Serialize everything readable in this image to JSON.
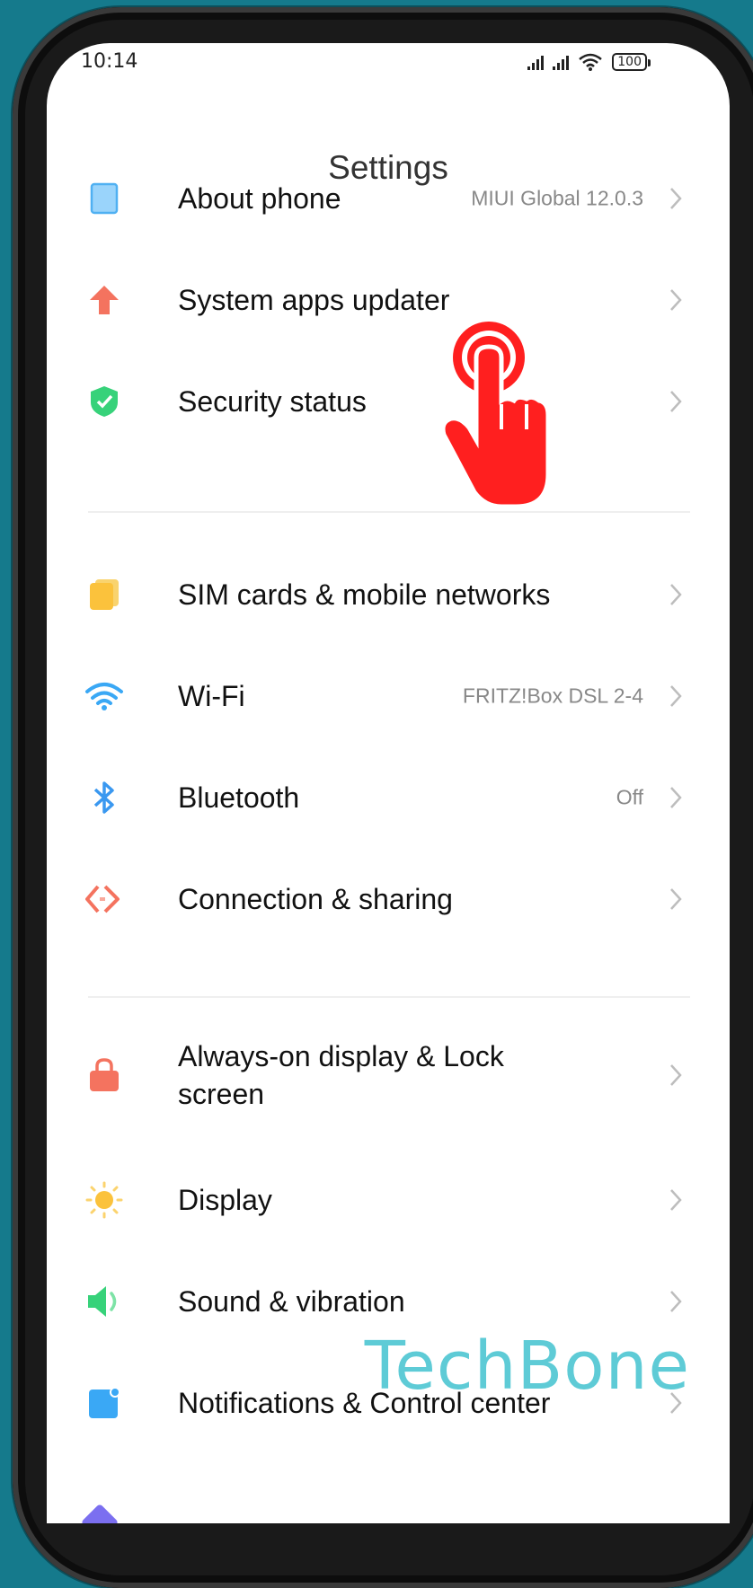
{
  "status_bar": {
    "time": "10:14",
    "battery": "100"
  },
  "header": {
    "title": "Settings"
  },
  "rows": [
    {
      "id": "about-phone",
      "label": "About phone",
      "value": "MIUI Global 12.0.3",
      "icon": "phone-icon",
      "color": "#62b8f5"
    },
    {
      "id": "system-apps-updater",
      "label": "System apps updater",
      "value": "",
      "icon": "arrow-up-icon",
      "color": "#f4735f"
    },
    {
      "id": "security-status",
      "label": "Security status",
      "value": "",
      "icon": "shield-check-icon",
      "color": "#37d27a"
    },
    {
      "id": "sim-cards",
      "label": "SIM cards & mobile networks",
      "value": "",
      "icon": "sim-card-icon",
      "color": "#fbc23c"
    },
    {
      "id": "wifi",
      "label": "Wi-Fi",
      "value": "FRITZ!Box DSL 2-4",
      "icon": "wifi-icon",
      "color": "#3aa8f5"
    },
    {
      "id": "bluetooth",
      "label": "Bluetooth",
      "value": "Off",
      "icon": "bluetooth-icon",
      "color": "#3a98f0"
    },
    {
      "id": "connection-sharing",
      "label": "Connection & sharing",
      "value": "",
      "icon": "connection-icon",
      "color": "#f4735f"
    },
    {
      "id": "always-on-display",
      "label": "Always-on display & Lock screen",
      "value": "",
      "icon": "lock-icon",
      "color": "#f4735f"
    },
    {
      "id": "display",
      "label": "Display",
      "value": "",
      "icon": "sun-icon",
      "color": "#fbc23c"
    },
    {
      "id": "sound-vibration",
      "label": "Sound & vibration",
      "value": "",
      "icon": "speaker-icon",
      "color": "#37d27a"
    },
    {
      "id": "notifications",
      "label": "Notifications & Control center",
      "value": "",
      "icon": "notification-icon",
      "color": "#3aa8f5"
    }
  ],
  "watermark": "TechBone",
  "colors": {
    "accent_hand": "#ff1f1f",
    "chevron": "#bdbdbd",
    "background": "#157a8c"
  }
}
